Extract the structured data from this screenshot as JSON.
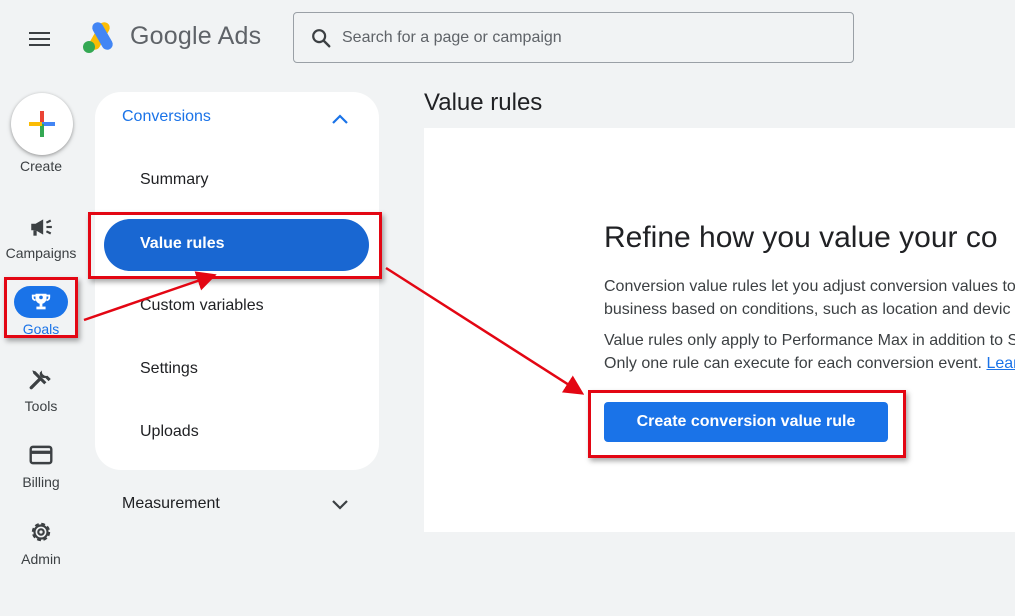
{
  "header": {
    "brand_google": "Google",
    "brand_ads": "Ads",
    "search_placeholder": "Search for a page or campaign"
  },
  "rail": {
    "create_label": "Create",
    "items": [
      {
        "label": "Campaigns",
        "icon": "megaphone-icon"
      },
      {
        "label": "Goals",
        "icon": "trophy-icon",
        "active": true
      },
      {
        "label": "Tools",
        "icon": "tools-icon"
      },
      {
        "label": "Billing",
        "icon": "credit-card-icon"
      },
      {
        "label": "Admin",
        "icon": "gear-icon"
      }
    ]
  },
  "subnav": {
    "conversions_label": "Conversions",
    "items": [
      "Summary",
      "Value rules",
      "Custom variables",
      "Settings",
      "Uploads"
    ],
    "selected": "Value rules",
    "measurement_label": "Measurement"
  },
  "main": {
    "page_title": "Value rules",
    "heading": "Refine how you value your co",
    "para1_line1": "Conversion value rules let you adjust conversion values to",
    "para1_line2": "business based on conditions, such as location and devic",
    "para2_line1": "Value rules only apply to Performance Max in addition to S",
    "para2_line2": "Only one rule can execute for each conversion event. ",
    "learn_more": "Lear",
    "cta_label": "Create conversion value rule"
  },
  "colors": {
    "accent": "#1a73e8",
    "annotation": "#e30613"
  }
}
